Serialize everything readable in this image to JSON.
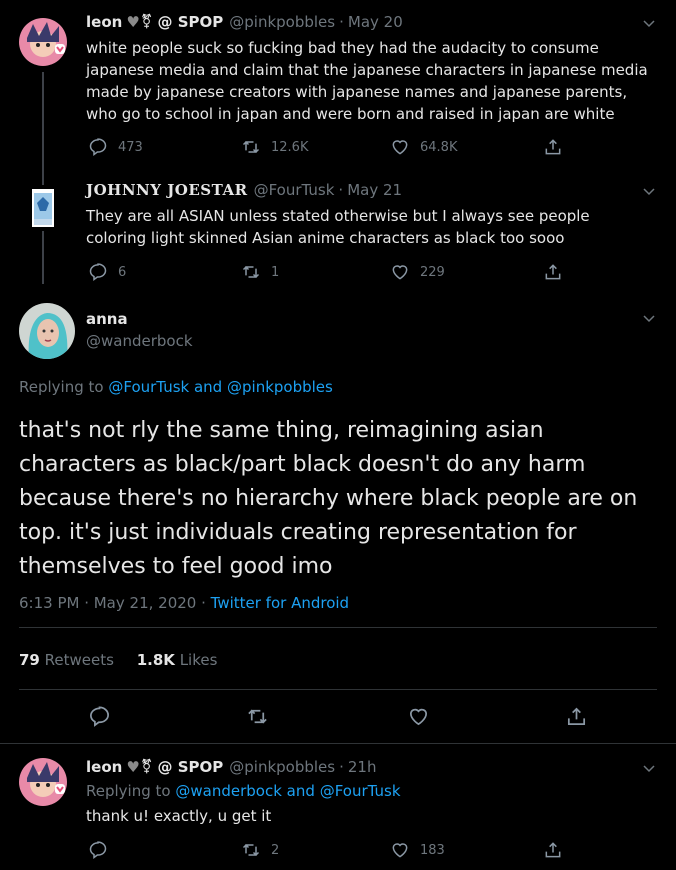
{
  "tweet1": {
    "name": "leon",
    "name_suffix": "@ SPOP",
    "handle": "@pinkpobbles",
    "date": "May 20",
    "text": "white people suck so fucking bad they had the audacity to consume japanese media and claim that the japanese characters in japanese media made by japanese creators with japanese names and japanese parents, who go to school in japan and were born and raised in japan are white",
    "replies": "473",
    "retweets": "12.6K",
    "likes": "64.8K"
  },
  "tweet2": {
    "name": "JOHNNY JOESTAR",
    "handle": "@FourTusk",
    "date": "May 21",
    "text": "They are all ASIAN unless stated otherwise but I always see people coloring light skinned Asian anime characters as black too sooo",
    "replies": "6",
    "retweets": "1",
    "likes": "229"
  },
  "main": {
    "name": "anna",
    "handle": "@wanderbock",
    "replying_label": "Replying to",
    "replying_to_1": "@FourTusk",
    "replying_and": "and",
    "replying_to_2": "@pinkpobbles",
    "text": "that's not rly the same thing, reimagining asian characters as black/part black doesn't do any harm because there's no hierarchy where black people are on top. it's just individuals creating representation for themselves to feel good imo",
    "time": "6:13 PM · May 21, 2020 ·",
    "source": "Twitter for Android",
    "retweets_count": "79",
    "retweets_label": "Retweets",
    "likes_count": "1.8K",
    "likes_label": "Likes"
  },
  "reply": {
    "name": "leon",
    "name_suffix": "@ SPOP",
    "handle": "@pinkpobbles",
    "date": "21h",
    "replying_label": "Replying to",
    "replying_to_1": "@wanderbock",
    "replying_and": "and",
    "replying_to_2": "@FourTusk",
    "text": "thank u! exactly, u get it",
    "retweets": "2",
    "likes": "183"
  },
  "colors": {
    "link": "#1da1f2",
    "muted": "#6e767d",
    "text": "#e6e6e6",
    "background": "#000000"
  }
}
